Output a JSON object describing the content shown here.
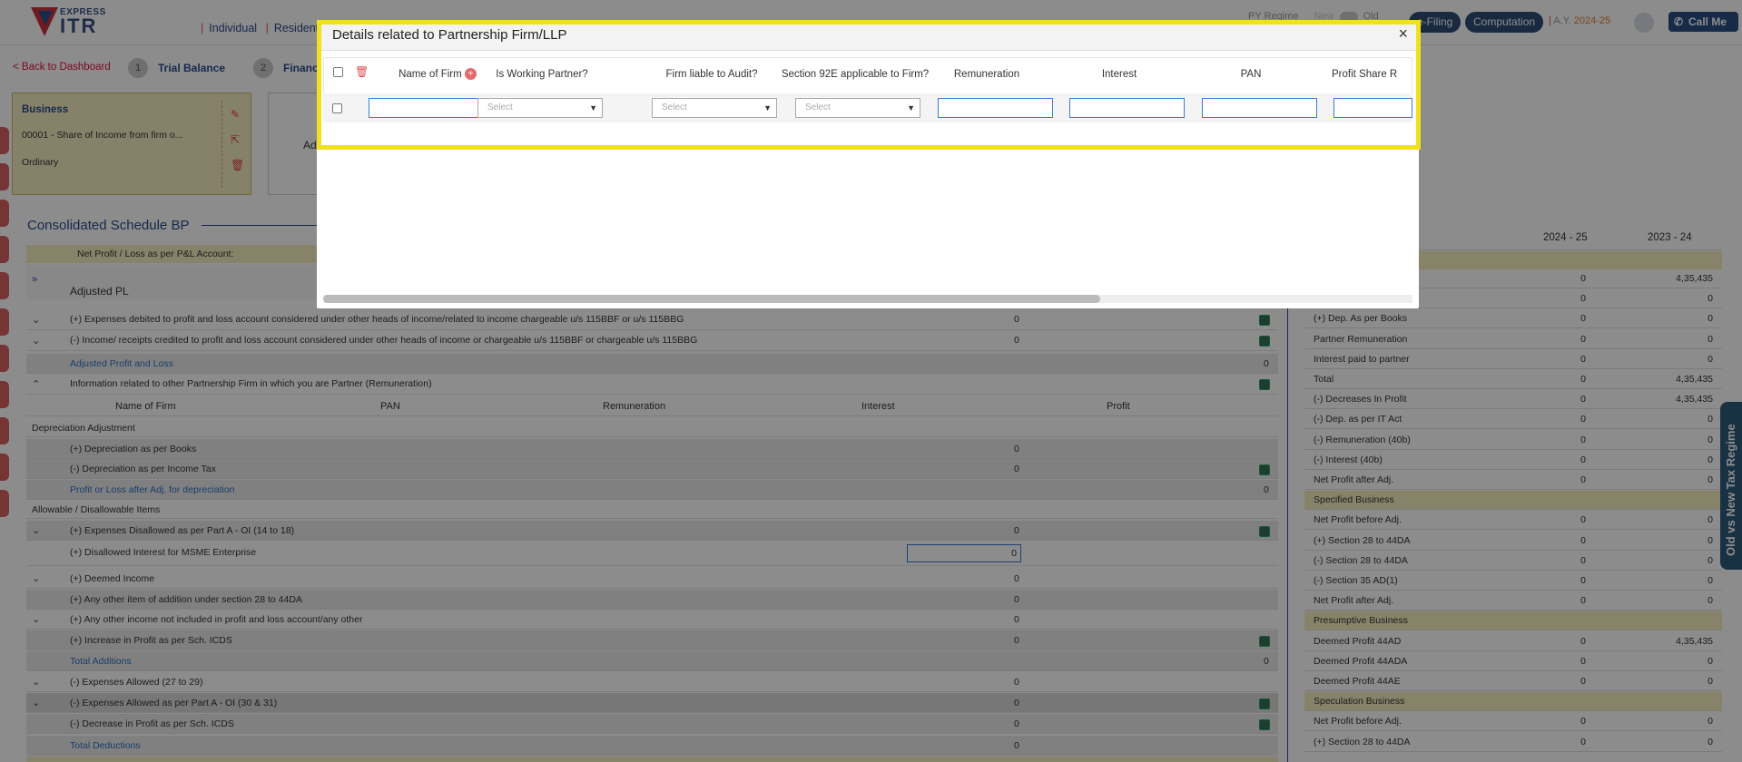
{
  "header": {
    "logo_top": "EXPRESS",
    "logo_bottom": "ITR",
    "nav": [
      "Individual",
      "Resident"
    ],
    "regime_label": "PY Regime",
    "regime_new": "New",
    "regime_old": "Old",
    "efiling": "e-Filing",
    "computation": "Computation",
    "ay_label": "A.Y.",
    "ay_value": "2024-25",
    "call_me": "Call Me"
  },
  "nav": {
    "back": "< Back to Dashboard",
    "step1_num": "1",
    "step1_label": "Trial Balance",
    "step2_num": "2",
    "step2_label": "Financ"
  },
  "business_card": {
    "title": "Business",
    "line1": "00001 - Share of Income from firm o...",
    "line2": "Ordinary"
  },
  "card2_label": "Ad",
  "schedule": {
    "title": "Consolidated Schedule BP",
    "net_profit_label": "Net Profit / Loss as per P&L Account:",
    "adjusted_pl": "Adjusted PL",
    "rows": [
      {
        "label": "(+) Expenses debited to profit and loss account considered under other heads of income/related to income chargeable u/s 115BBF or u/s 115BBG",
        "value": "0"
      },
      {
        "label": "(-) Income/ receipts credited to profit and loss account considered under other heads of income or chargeable u/s 115BBF or chargeable u/s 115BBG",
        "value": "0"
      },
      {
        "label": "Adjusted Profit and Loss",
        "value": "0"
      },
      {
        "label": "Information related to other Partnership Firm in which you are Partner (Remuneration)",
        "value": ""
      },
      {
        "label": "Depreciation Adjustment",
        "value": ""
      },
      {
        "label": "(+) Depreciation as per Books",
        "value": "0"
      },
      {
        "label": "(-) Depreciation as per Income Tax",
        "value": "0"
      },
      {
        "label": "Profit or Loss after Adj. for depreciation",
        "value": "0"
      },
      {
        "label": "Allowable / Disallowable Items",
        "value": ""
      },
      {
        "label": "(+) Expenses Disallowed as per Part A - OI (14 to 18)",
        "value": "0"
      },
      {
        "label": "(+) Disallowed Interest for MSME Enterprise",
        "value": "0"
      },
      {
        "label": "(+) Deemed Income",
        "value": "0"
      },
      {
        "label": "(+) Any other item of addition under section 28 to 44DA",
        "value": "0"
      },
      {
        "label": "(+) Any other income not included in profit and loss account/any other",
        "value": "0"
      },
      {
        "label": "(+) Increase in Profit as per Sch. ICDS",
        "value": "0"
      },
      {
        "label": "Total Additions",
        "value": "0"
      },
      {
        "label": "(-) Expenses Allowed (27 to 29)",
        "value": "0"
      },
      {
        "label": "(-) Expenses Allowed as per Part A - OI (30 & 31)",
        "value": "0"
      },
      {
        "label": "(-) Decrease in Profit as per Sch. ICDS",
        "value": "0"
      },
      {
        "label": "Total Deductions",
        "value": "0"
      }
    ],
    "partner_cols": [
      "Name of Firm",
      "PAN",
      "Remuneration",
      "Interest",
      "Profit"
    ]
  },
  "right_panel": {
    "col1": "2024 - 25",
    "col2": "2023 - 24",
    "rows": [
      {
        "label": "",
        "a": "0",
        "b": "4,35,435",
        "style": "w"
      },
      {
        "label": "",
        "a": "0",
        "b": "0",
        "style": "w"
      },
      {
        "label": "(+) Dep. As per Books",
        "a": "0",
        "b": "0",
        "style": "w"
      },
      {
        "label": "Partner Remuneration",
        "a": "0",
        "b": "0",
        "style": "w"
      },
      {
        "label": "Interest paid to partner",
        "a": "0",
        "b": "0",
        "style": "w"
      },
      {
        "label": "Total",
        "a": "0",
        "b": "4,35,435",
        "style": "w"
      },
      {
        "label": "(-) Decreases In Profit",
        "a": "0",
        "b": "4,35,435",
        "style": "w"
      },
      {
        "label": "(-) Dep. as per IT Act",
        "a": "0",
        "b": "0",
        "style": "w"
      },
      {
        "label": "(-) Remuneration (40b)",
        "a": "0",
        "b": "0",
        "style": "w"
      },
      {
        "label": "(-) Interest (40b)",
        "a": "0",
        "b": "0",
        "style": "w"
      },
      {
        "label": "Net Profit after Adj.",
        "a": "0",
        "b": "0",
        "style": "w"
      },
      {
        "label": "Specified Business",
        "a": "",
        "b": "",
        "style": "yel"
      },
      {
        "label": "Net Profit before Adj.",
        "a": "0",
        "b": "0",
        "style": "w"
      },
      {
        "label": "(+) Section 28 to 44DA",
        "a": "0",
        "b": "0",
        "style": "w"
      },
      {
        "label": "(-) Section 28 to 44DA",
        "a": "0",
        "b": "0",
        "style": "w"
      },
      {
        "label": "(-) Section 35 AD(1)",
        "a": "0",
        "b": "0",
        "style": "w"
      },
      {
        "label": "Net Profit after Adj.",
        "a": "0",
        "b": "0",
        "style": "w"
      },
      {
        "label": "Presumptive Business",
        "a": "",
        "b": "",
        "style": "yel"
      },
      {
        "label": "Deemed Profit 44AD",
        "a": "0",
        "b": "4,35,435",
        "style": "w"
      },
      {
        "label": "Deemed Profit 44ADA",
        "a": "0",
        "b": "0",
        "style": "w"
      },
      {
        "label": "Deemed Profit 44AE",
        "a": "0",
        "b": "0",
        "style": "w"
      },
      {
        "label": "Speculation Business",
        "a": "",
        "b": "",
        "style": "yel"
      },
      {
        "label": "Net Profit before Adj.",
        "a": "0",
        "b": "0",
        "style": "w"
      },
      {
        "label": "(+) Section 28 to 44DA",
        "a": "0",
        "b": "0",
        "style": "w"
      }
    ],
    "vtab": "Old vs New Tax Regime"
  },
  "modal": {
    "title": "Details related to Partnership Firm/LLP",
    "close": "×",
    "columns": [
      "Name of Firm",
      "Is Working Partner?",
      "Firm liable to Audit?",
      "Section 92E applicable to Firm?",
      "Remuneration",
      "Interest",
      "PAN",
      "Profit Share R"
    ],
    "select_placeholder": "Select",
    "plus": "+"
  }
}
